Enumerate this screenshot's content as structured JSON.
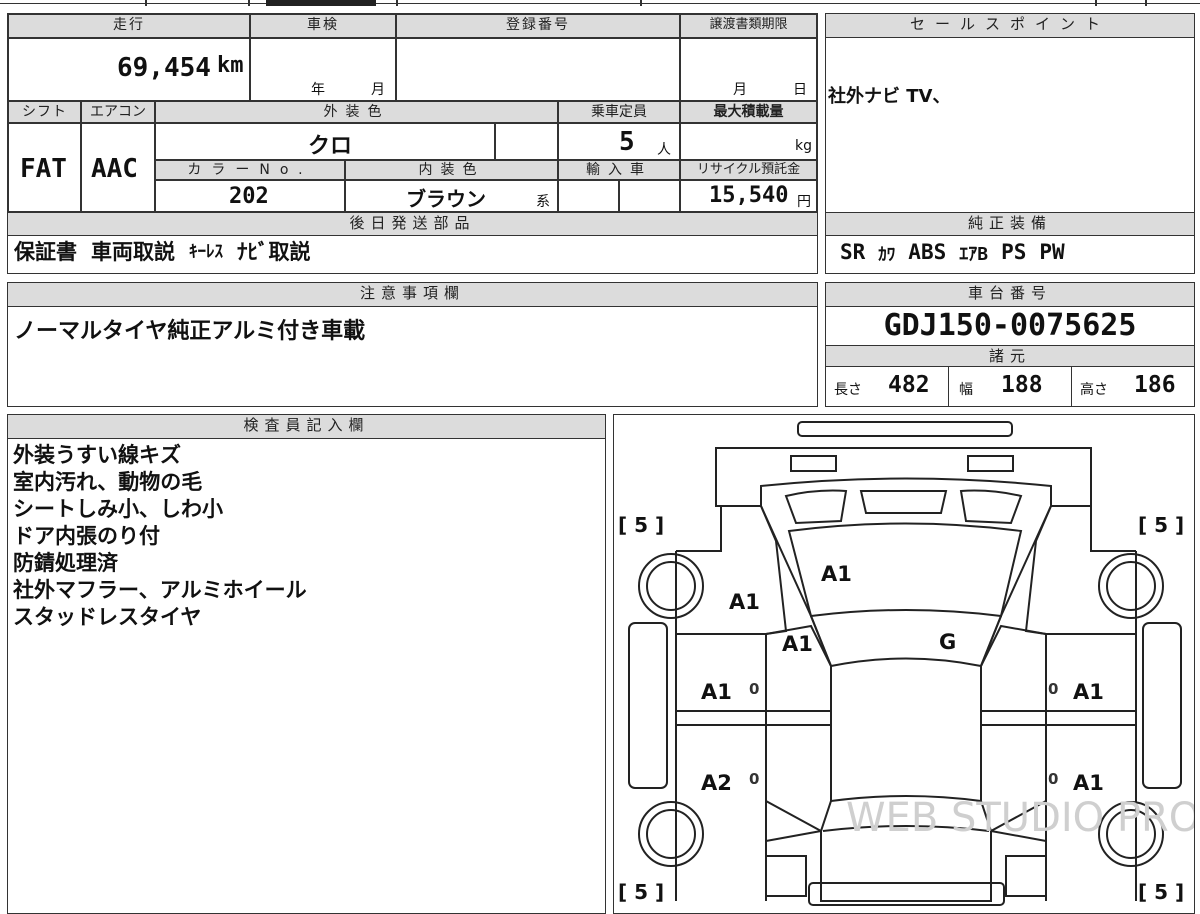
{
  "mileage": {
    "label": "走行",
    "value": "69,454",
    "unit": "km"
  },
  "inspection": {
    "label": "車検",
    "year": "年",
    "month": "月"
  },
  "registration": {
    "label": "登録番号"
  },
  "transfer": {
    "label": "譲渡書類期限",
    "month": "月",
    "day": "日"
  },
  "sales_point": {
    "label": "セールスポイント",
    "text": "社外ナビ TV、"
  },
  "shift": {
    "label": "シフト",
    "value": "FAT"
  },
  "aircon": {
    "label": "エアコン",
    "value": "AAC"
  },
  "exterior_color": {
    "label": "外装色",
    "value": "クロ"
  },
  "capacity": {
    "label": "乗車定員",
    "value": "5",
    "unit": "人"
  },
  "max_load": {
    "label": "最大積載量",
    "unit": "kg"
  },
  "color_no": {
    "label": "カラーNo.",
    "value": "202"
  },
  "interior_color": {
    "label": "内装色",
    "value": "ブラウン",
    "suffix": "系"
  },
  "import": {
    "label": "輸入車"
  },
  "recycle": {
    "label": "リサイクル預託金",
    "value": "15,540",
    "unit": "円"
  },
  "later_parts": {
    "label": "後日発送部品",
    "items": [
      "保証書",
      "車両取説",
      "ｷｰﾚｽ",
      "ﾅﾋﾞ取説"
    ]
  },
  "standard_equipment": {
    "label": "純正装備",
    "items": [
      "SR",
      "ｶﾜ",
      "ABS",
      "ｴｱB",
      "PS",
      "PW"
    ]
  },
  "notes": {
    "label": "注意事項欄",
    "text": "ノーマルタイヤ純正アルミ付き車載"
  },
  "chassis": {
    "label": "車台番号",
    "value": "GDJ150-0075625"
  },
  "specs": {
    "label": "諸元",
    "length_label": "長さ",
    "length": "482",
    "width_label": "幅",
    "width": "188",
    "height_label": "高さ",
    "height": "186"
  },
  "inspector": {
    "label": "検査員記入欄",
    "lines": [
      "外装うすい線キズ",
      "室内汚れ、動物の毛",
      "シートしみ小、しわ小",
      "ドア内張のり付",
      "防錆処理済",
      "社外マフラー、アルミホイール",
      "スタッドレスタイヤ"
    ]
  },
  "diagram": {
    "tires": [
      "[ 5 ]",
      "[ 5 ]",
      "[ 5 ]",
      "[ 5 ]"
    ],
    "marks": [
      "A1",
      "A1",
      "A1",
      "G",
      "A1",
      "A1",
      "A2",
      "A1"
    ],
    "zeros": [
      "0",
      "0",
      "0",
      "0"
    ],
    "watermark": "WEB STUDIO PRO"
  }
}
